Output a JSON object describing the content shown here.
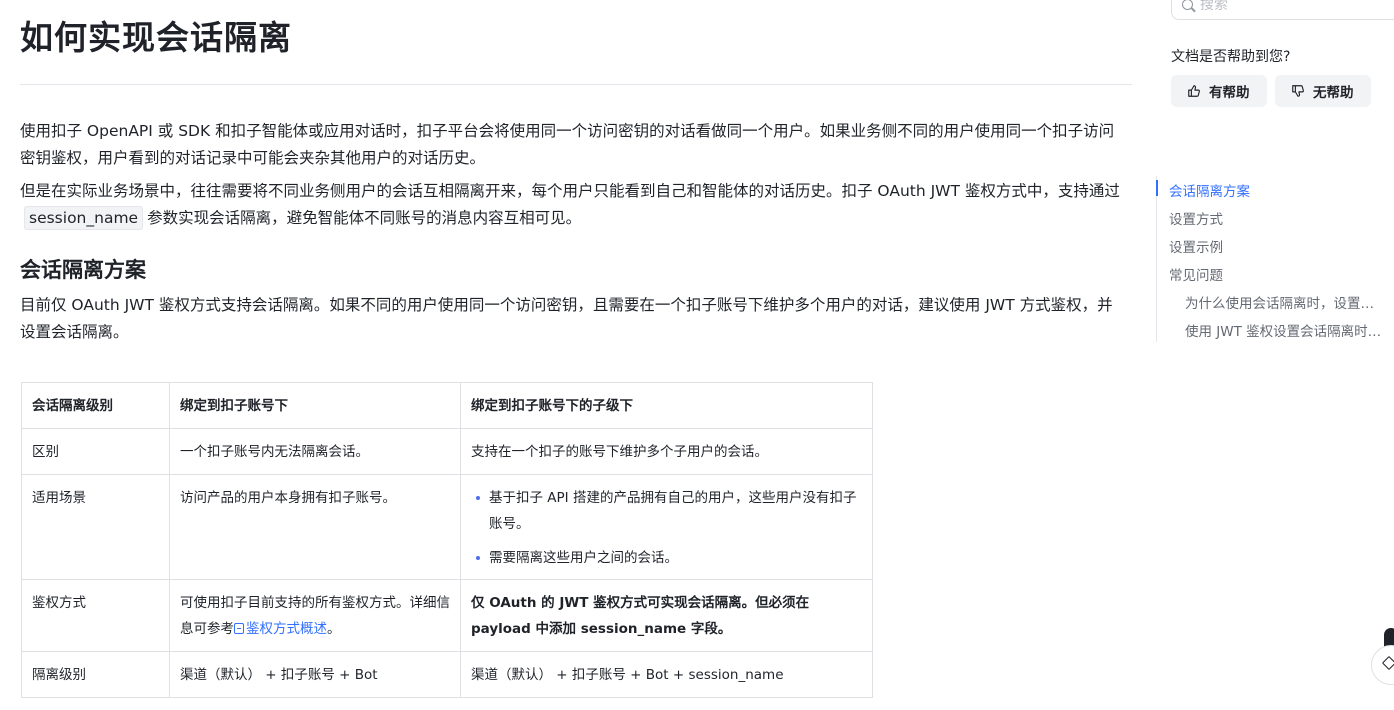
{
  "page": {
    "title": "如何实现会话隔离",
    "para1": "使用扣子 OpenAPI 或 SDK 和扣子智能体或应用对话时，扣子平台会将使用同一个访问密钥的对话看做同一个用户。如果业务侧不同的用户使用同一个扣子访问密钥鉴权，用户看到的对话记录中可能会夹杂其他用户的对话历史。",
    "para2_before": "但是在实际业务场景中，往往需要将不同业务侧用户的会话互相隔离开来，每个用户只能看到自己和智能体的对话历史。扣子 OAuth JWT 鉴权方式中，支持通过",
    "para2_code": "session_name",
    "para2_after": "参数实现会话隔离，避免智能体不同账号的消息内容互相可见。",
    "section_title": "会话隔离方案",
    "section_para": "目前仅 OAuth JWT 鉴权方式支持会话隔离。如果不同的用户使用同一个访问密钥，且需要在一个扣子账号下维护多个用户的对话，建议使用 JWT 方式鉴权，并设置会话隔离。"
  },
  "table": {
    "headers": [
      "会话隔离级别",
      "绑定到扣子账号下",
      "绑定到扣子账号下的子级下"
    ],
    "row1": [
      "区别",
      "一个扣子账号内无法隔离会话。",
      "支持在一个扣子的账号下维护多个子用户的会话。"
    ],
    "row2": {
      "label": "适用场景",
      "col2": "访问产品的用户本身拥有扣子账号。",
      "bullets": [
        "基于扣子 API 搭建的产品拥有自己的用户，这些用户没有扣子账号。",
        "需要隔离这些用户之间的会话。"
      ]
    },
    "row3": {
      "label": "鉴权方式",
      "col2_before": "可使用扣子目前支持的所有鉴权方式。详细信息可参考",
      "col2_link": "鉴权方式概述",
      "col2_after": "。",
      "col3": "仅 OAuth 的 JWT 鉴权方式可实现会话隔离。但必须在 payload 中添加 session_name 字段。"
    },
    "row4": [
      "隔离级别",
      "渠道（默认） + 扣子账号 + Bot",
      "渠道（默认） + 扣子账号 + Bot + session_name"
    ]
  },
  "sidebar": {
    "search_placeholder": "搜索",
    "feedback_question": "文档是否帮助到您?",
    "helpful_label": "有帮助",
    "unhelpful_label": "无帮助",
    "toc": [
      "会话隔离方案",
      "设置方式",
      "设置示例",
      "常见问题",
      "为什么使用会话隔离时，设置…",
      "使用 JWT 鉴权设置会话隔离时…"
    ]
  },
  "colors": {
    "accent": "#3370ff",
    "text": "#1f2329",
    "muted": "#646a73",
    "border": "#dee0e3"
  }
}
